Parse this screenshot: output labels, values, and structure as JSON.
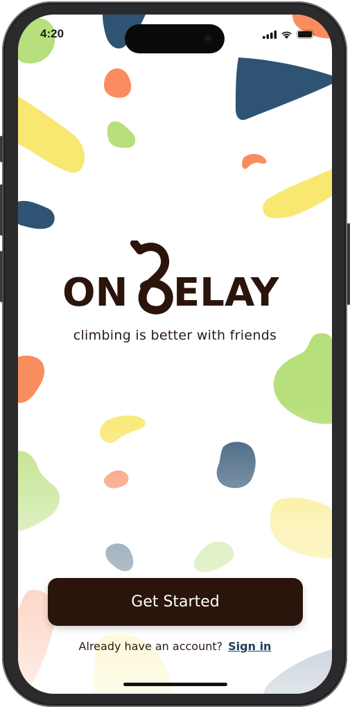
{
  "status_bar": {
    "time": "4:20",
    "icons": [
      "cellular-signal-icon",
      "wifi-icon",
      "battery-icon"
    ]
  },
  "brand": {
    "logo_text_left": "ON",
    "logo_text_right": "ELAY",
    "logo_colors": {
      "ink": "#2a140b"
    }
  },
  "tagline": "climbing is better with friends",
  "actions": {
    "get_started_label": "Get Started",
    "account_prompt": "Already have an account?",
    "sign_in_label": "Sign in"
  },
  "colors": {
    "button_bg": "#2a140b",
    "link": "#1d3d5c",
    "blob_navy": "#2f5372",
    "blob_orange": "#f98d5f",
    "blob_yellow": "#f8e872",
    "blob_green": "#b7df7b"
  }
}
